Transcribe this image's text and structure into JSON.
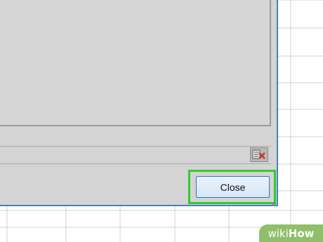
{
  "dialog": {
    "close_label": "Close",
    "tool_icon": "find-delete-icon"
  },
  "watermark": {
    "wiki": "wiki",
    "how": "How"
  },
  "colors": {
    "dialog_bg": "#d4d4d4",
    "dialog_border": "#4a7fc1",
    "highlight": "#2ecc2e",
    "button_border": "#2e75c7",
    "watermark_bg": "#8fbf6a"
  }
}
